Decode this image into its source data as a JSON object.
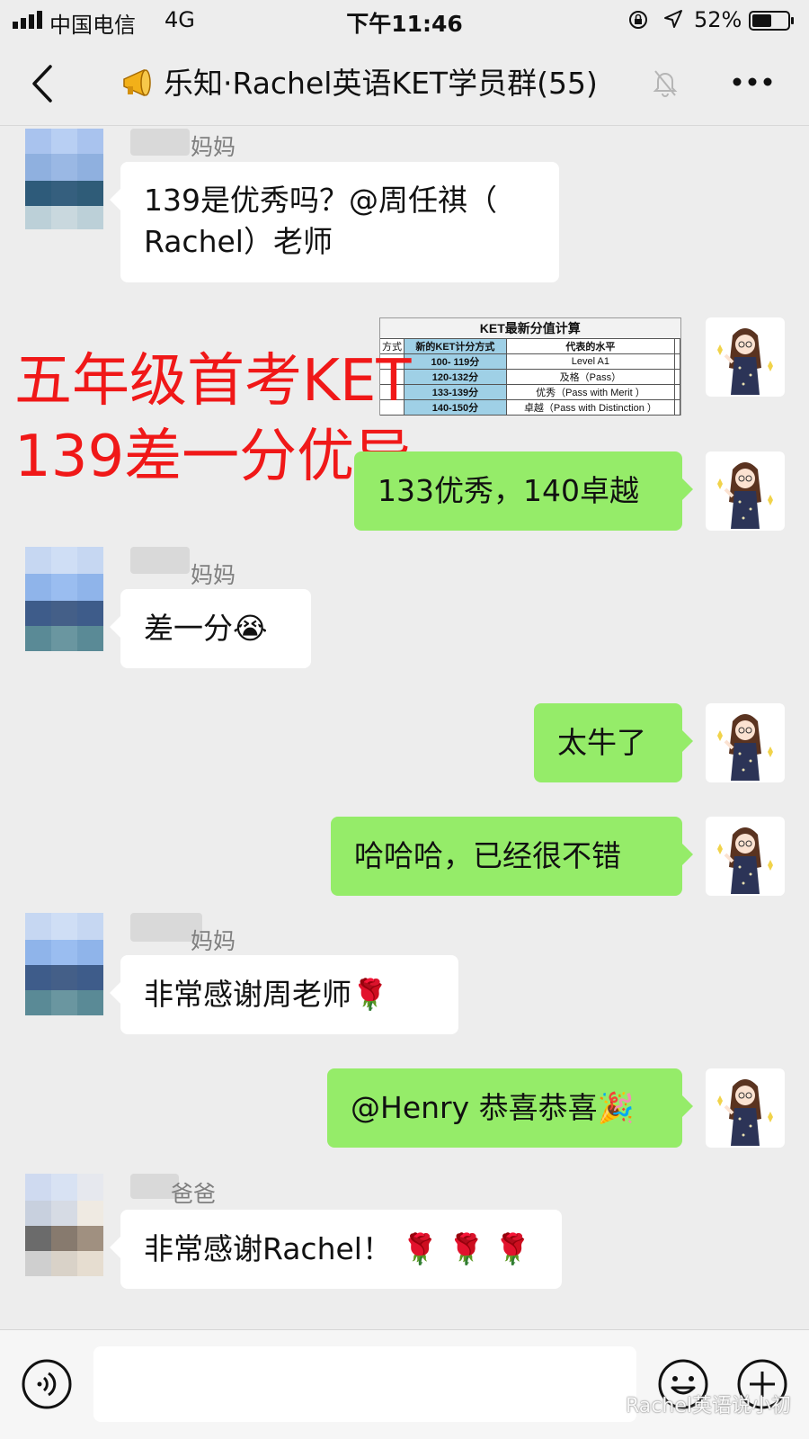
{
  "status_bar": {
    "carrier": "中国电信",
    "network": "4G",
    "time": "下午11:46",
    "battery": "52%"
  },
  "nav": {
    "title": "乐知·Rachel英语KET学员群(55)"
  },
  "overlay_caption": {
    "line1": "五年级首考KET",
    "line2": "139差一分优异"
  },
  "ket_table": {
    "title": "KET最新分值计算",
    "col_cut": "方式",
    "col_score": "新的KET计分方式",
    "col_level": "代表的水平",
    "rows": [
      {
        "score": "100- 119分",
        "level": "Level A1"
      },
      {
        "score": "120-132分",
        "level": "及格（Pass）"
      },
      {
        "score": "133-139分",
        "level": "优秀（Pass with Merit ）"
      },
      {
        "score": "140-150分",
        "level": "卓越（Pass with Distinction ）"
      }
    ]
  },
  "messages": {
    "m1_sender": "妈妈",
    "m1_text_line1": "139是优秀吗？@周任祺（",
    "m1_text_line2": "Rachel）老师",
    "m2_text": "133优秀，140卓越",
    "m3_sender": "妈妈",
    "m3_text": "差一分😭",
    "m4_text": "太牛了",
    "m5_text": "哈哈哈，已经很不错",
    "m6_sender": "妈妈",
    "m6_text": "非常感谢周老师🌹",
    "m7_text": "@Henry 恭喜恭喜🎉",
    "m8_sender": "爸爸",
    "m8_text": "非常感谢Rachel！ 🌹 🌹 🌹"
  },
  "watermark": "Rachel英语说小初",
  "icons": {
    "signal": "signal-icon",
    "lock": "orientation-lock-icon",
    "location": "location-icon",
    "battery": "battery-icon",
    "back": "back-chevron-icon",
    "megaphone": "megaphone-icon",
    "mute": "mute-bell-icon",
    "more": "more-dots-icon",
    "voice": "voice-icon",
    "emoji": "emoji-icon",
    "plus": "plus-icon"
  },
  "colors": {
    "background": "#ededed",
    "bubble_self": "#95ec69",
    "bubble_other": "#ffffff",
    "caption": "#f01818"
  }
}
